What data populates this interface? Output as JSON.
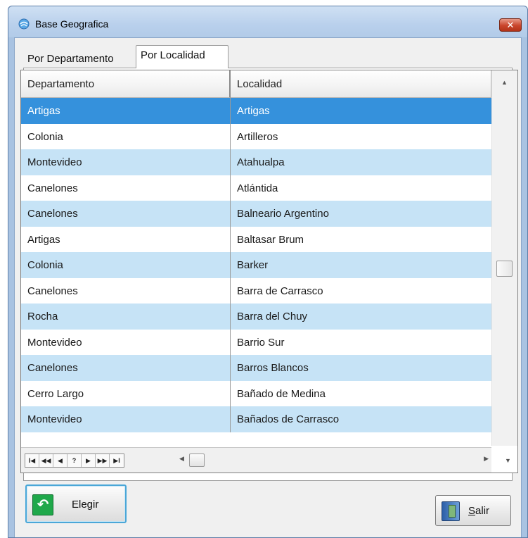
{
  "window": {
    "title": "Base Geografica",
    "close_label": "✕"
  },
  "tabs": [
    {
      "label": "Por Departamento",
      "active": false
    },
    {
      "label": "Por Localidad",
      "active": true
    }
  ],
  "grid": {
    "columns": [
      "Departamento",
      "Localidad"
    ],
    "selected_index": 0,
    "rows": [
      {
        "departamento": "Artigas",
        "localidad": "Artigas"
      },
      {
        "departamento": "Colonia",
        "localidad": "Artilleros"
      },
      {
        "departamento": "Montevideo",
        "localidad": "Atahualpa"
      },
      {
        "departamento": "Canelones",
        "localidad": "Atlántida"
      },
      {
        "departamento": "Canelones",
        "localidad": "Balneario Argentino"
      },
      {
        "departamento": "Artigas",
        "localidad": "Baltasar Brum"
      },
      {
        "departamento": "Colonia",
        "localidad": "Barker"
      },
      {
        "departamento": "Canelones",
        "localidad": "Barra de Carrasco"
      },
      {
        "departamento": "Rocha",
        "localidad": "Barra del Chuy"
      },
      {
        "departamento": "Montevideo",
        "localidad": "Barrio Sur"
      },
      {
        "departamento": "Canelones",
        "localidad": "Barros Blancos"
      },
      {
        "departamento": "Cerro Largo",
        "localidad": "Bañado de Medina"
      },
      {
        "departamento": "Montevideo",
        "localidad": "Bañados de Carrasco"
      }
    ],
    "nav_buttons": [
      "I◀",
      "◀◀",
      "◀",
      "?",
      "▶",
      "▶▶",
      "▶I"
    ]
  },
  "buttons": {
    "elegir_label": "Elegir",
    "salir_label_underlined": "S",
    "salir_label_rest": "alir"
  },
  "colors": {
    "selected_row": "#3591dc",
    "alt_row": "#c6e3f6"
  }
}
